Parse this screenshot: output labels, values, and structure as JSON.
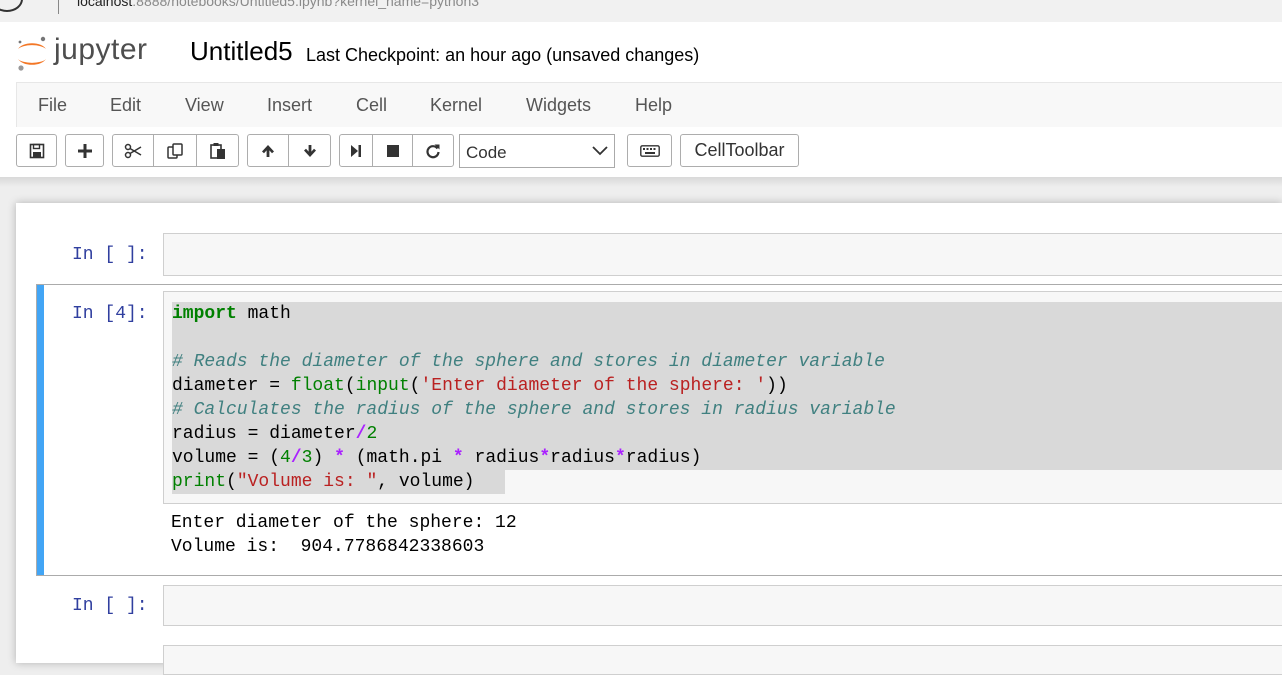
{
  "browser": {
    "url_host": "localhost",
    "url_rest": ":8888/notebooks/Untitled5.ipynb?kernel_name=python3"
  },
  "header": {
    "logo_text": "jupyter",
    "notebook_name": "Untitled5",
    "checkpoint": "Last Checkpoint: an hour ago (unsaved changes)"
  },
  "menu": {
    "file": "File",
    "edit": "Edit",
    "view": "View",
    "insert": "Insert",
    "cell": "Cell",
    "kernel": "Kernel",
    "widgets": "Widgets",
    "help": "Help"
  },
  "toolbar": {
    "cell_type": "Code",
    "celltoolbar_label": "CellToolbar",
    "icons": [
      "save-icon",
      "plus-icon",
      "cut-icon",
      "copy-icon",
      "paste-icon",
      "arrow-up-icon",
      "arrow-down-icon",
      "step-forward-icon",
      "stop-icon",
      "redo-icon",
      "keyboard-icon"
    ]
  },
  "cells": {
    "c1": {
      "prompt": "In [ ]:"
    },
    "c2": {
      "prompt": "In [4]:",
      "code": {
        "l1_kw": "import",
        "l1_rest": " math",
        "l3": "# Reads the diameter of the sphere and stores in diameter variable",
        "l4_a": "diameter = ",
        "l4_fn1": "float",
        "l4_b": "(",
        "l4_fn2": "input",
        "l4_c": "(",
        "l4_str": "'Enter diameter of the sphere: '",
        "l4_d": "))",
        "l5": "# Calculates the radius of the sphere and stores in radius variable",
        "l6_a": "radius = diameter",
        "l6_op": "/",
        "l6_num": "2",
        "l7_a": "volume = (",
        "l7_n1": "4",
        "l7_op1": "/",
        "l7_n2": "3",
        "l7_b": ") ",
        "l7_op2": "*",
        "l7_c": " (math.pi ",
        "l7_op3": "*",
        "l7_d": " radius",
        "l7_op4": "*",
        "l7_e": "radius",
        "l7_op5": "*",
        "l7_f": "radius)",
        "l8_fn": "print",
        "l8_a": "(",
        "l8_str": "\"Volume is: \"",
        "l8_b": ", volume)"
      },
      "output": [
        "Enter diameter of the sphere: 12",
        "Volume is:  904.7786842338603"
      ]
    },
    "c3": {
      "prompt": "In [ ]:"
    }
  },
  "colors": {
    "prompt": "#303f9f",
    "selected_cell_bar": "#42a5f5",
    "keyword": "#008000",
    "comment": "#408080",
    "string": "#ba2121",
    "operator": "#aa22ff"
  }
}
